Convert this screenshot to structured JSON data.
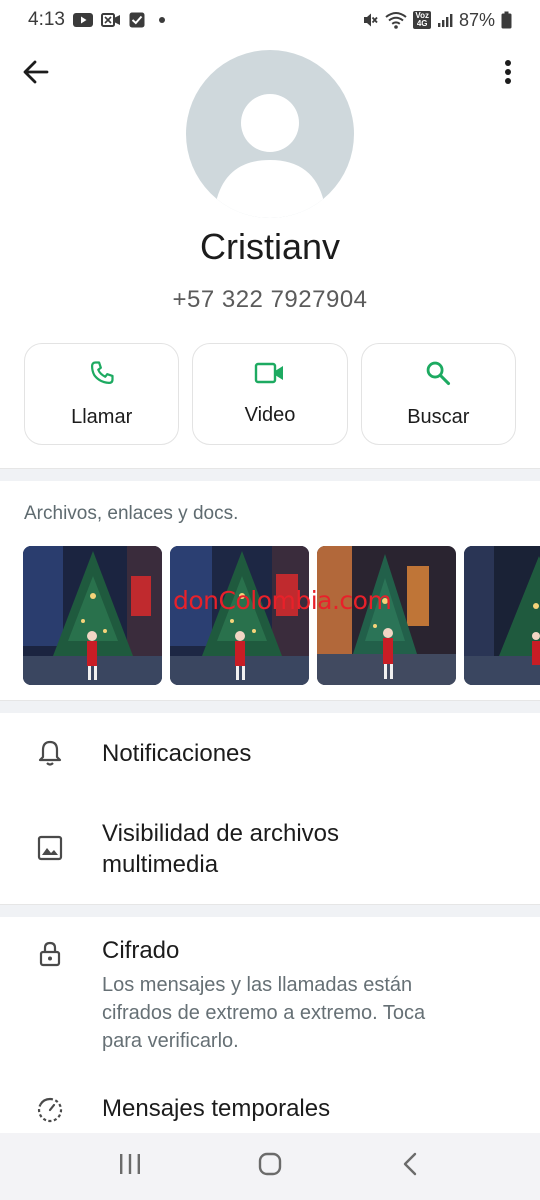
{
  "status_bar": {
    "time": "4:13",
    "battery": "87%",
    "icons_left": [
      "youtube-icon",
      "meet-icon",
      "check-icon",
      "dot-icon"
    ],
    "icons_right": [
      "mute-icon",
      "wifi-icon",
      "volte-icon",
      "signal-icon",
      "battery-icon"
    ],
    "volte_text_top": "Voz",
    "volte_text_bottom": "4G"
  },
  "contact": {
    "name": "Cristianv",
    "phone": "+57 322 7927904"
  },
  "actions": [
    {
      "label": "Llamar",
      "icon": "phone-icon"
    },
    {
      "label": "Video",
      "icon": "video-icon"
    },
    {
      "label": "Buscar",
      "icon": "search-icon"
    }
  ],
  "media": {
    "title": "Archivos, enlaces y docs.",
    "watermark": "donColombia.com"
  },
  "settings": {
    "notifications": "Notificaciones",
    "media_visibility_line1": "Visibilidad de archivos",
    "media_visibility_line2": "multimedia",
    "encryption_title": "Cifrado",
    "encryption_sub_1": "Los mensajes y las llamadas están",
    "encryption_sub_2": "cifrados de extremo a extremo. Toca",
    "encryption_sub_3": "para verificarlo.",
    "disappearing": "Mensajes temporales"
  },
  "colors": {
    "accent_green": "#1daa61",
    "avatar_bg": "#cfd8dc"
  }
}
